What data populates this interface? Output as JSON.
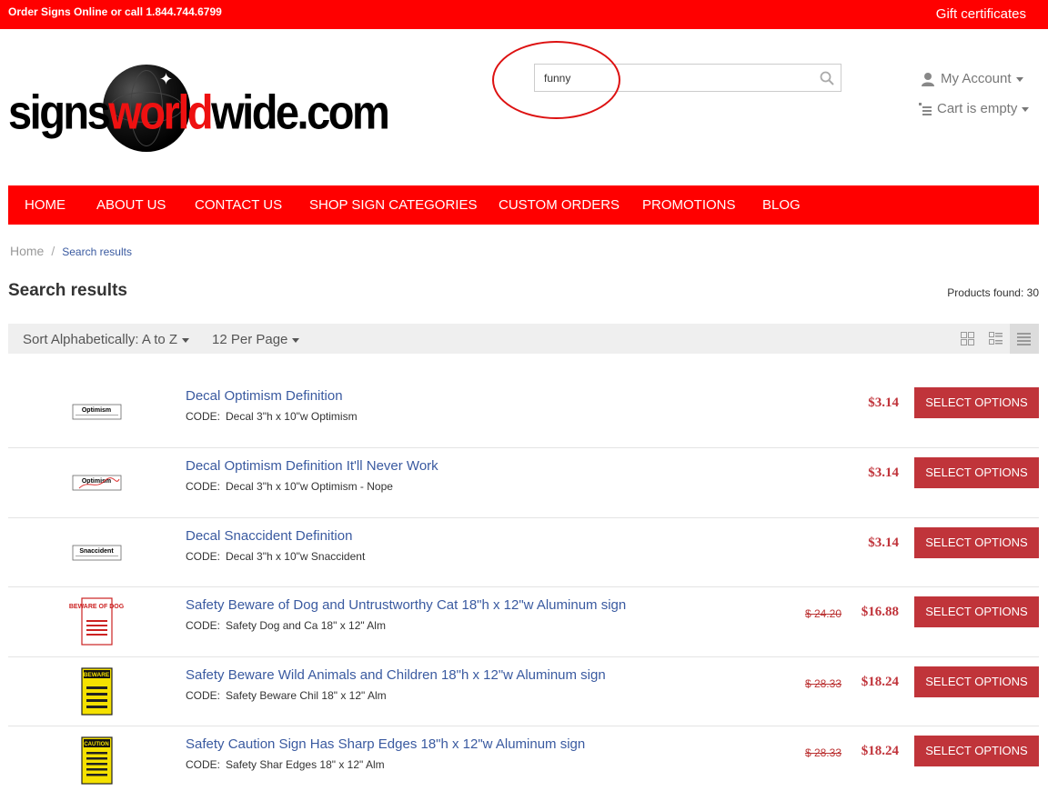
{
  "topbar": {
    "phone_text": "Order Signs Online or call 1.844.744.6799",
    "gift_link": "Gift certificates",
    "color": "#ff0000"
  },
  "logo": {
    "part1": "signs",
    "part2": "world",
    "part3": "wide.com"
  },
  "search": {
    "value": "funny",
    "icon": "search-icon"
  },
  "account": {
    "label": "My Account",
    "icon": "user-icon"
  },
  "cart": {
    "label": "Cart is empty",
    "icon": "cart-icon"
  },
  "nav": {
    "items": [
      "HOME",
      "ABOUT US",
      "CONTACT US",
      "SHOP SIGN CATEGORIES",
      "CUSTOM ORDERS",
      "PROMOTIONS",
      "BLOG"
    ]
  },
  "breadcrumb": {
    "home": "Home",
    "sep": "/",
    "current": "Search results"
  },
  "page_title": "Search results",
  "products_found": "Products found: 30",
  "sort": {
    "sort_label": "Sort Alphabetically: A to Z",
    "per_page_label": "12 Per Page"
  },
  "view_modes": [
    "grid-view-icon",
    "list-view-icon",
    "compact-list-icon"
  ],
  "button_label": "SELECT OPTIONS",
  "colors": {
    "accent": "#ff0000",
    "button": "#c0343a",
    "price": "#c0333a",
    "link": "#3a5aa0"
  },
  "products": [
    {
      "name": "Decal Optimism Definition",
      "code_label": "CODE:",
      "code": "Decal 3\"h x 10\"w Optimism",
      "old_price": "",
      "price": "$3.14",
      "thumb_text": "Optimism"
    },
    {
      "name": "Decal Optimism Definition It'll Never Work",
      "code_label": "CODE:",
      "code": "Decal 3\"h x 10\"w Optimism - Nope",
      "old_price": "",
      "price": "$3.14",
      "thumb_text": "Optimism"
    },
    {
      "name": "Decal Snaccident Definition",
      "code_label": "CODE:",
      "code": "Decal 3\"h x 10\"w Snaccident",
      "old_price": "",
      "price": "$3.14",
      "thumb_text": "Snaccident"
    },
    {
      "name": "Safety Beware of Dog and Untrustworthy Cat 18\"h x 12\"w Aluminum sign",
      "code_label": "CODE:",
      "code": "Safety Dog and Ca 18\" x 12\" Alm",
      "old_price": "$ 24.20",
      "price": "$16.88",
      "thumb_text": "BEWARE OF DOG"
    },
    {
      "name": "Safety Beware Wild Animals and Children 18\"h x 12\"w Aluminum sign",
      "code_label": "CODE:",
      "code": "Safety Beware Chil 18\" x 12\" Alm",
      "old_price": "$ 28.33",
      "price": "$18.24",
      "thumb_text": "BEWARE"
    },
    {
      "name": "Safety Caution Sign Has Sharp Edges 18\"h x 12\"w Aluminum sign",
      "code_label": "CODE:",
      "code": "Safety Shar Edges 18\" x 12\" Alm",
      "old_price": "$ 28.33",
      "price": "$18.24",
      "thumb_text": "CAUTION"
    }
  ]
}
